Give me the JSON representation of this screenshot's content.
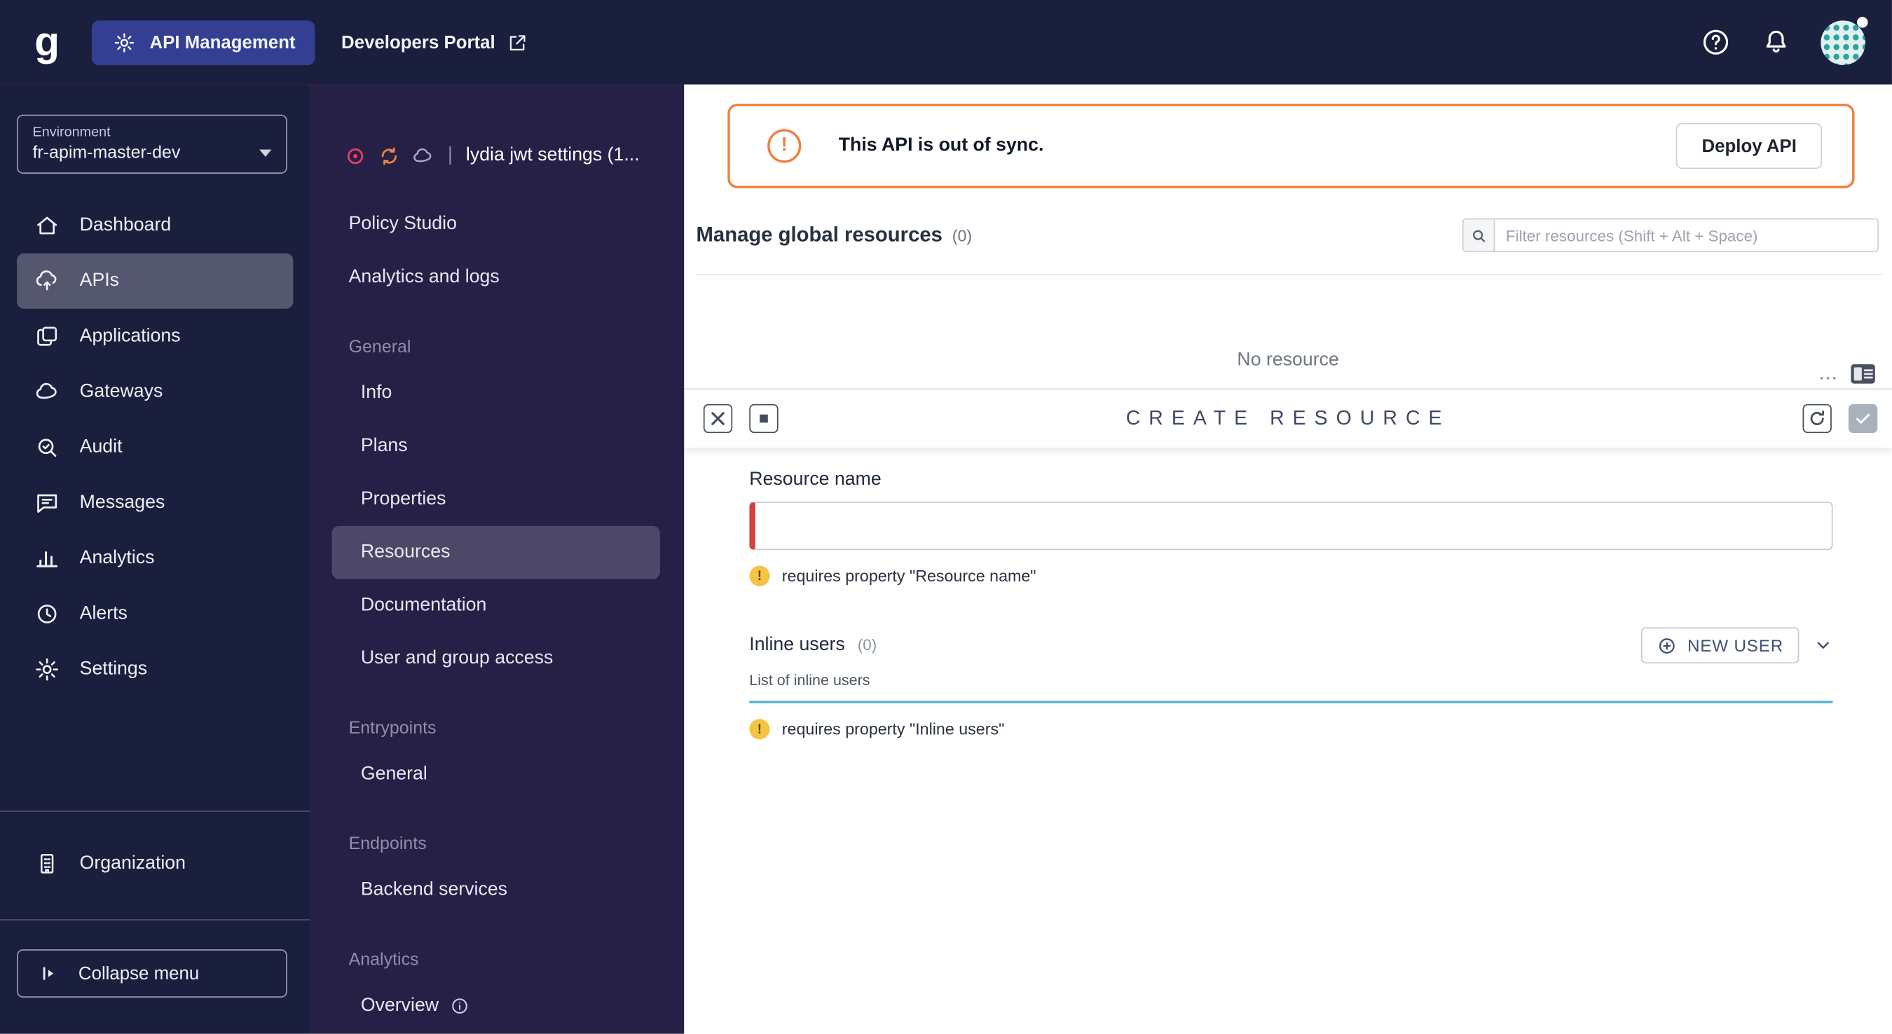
{
  "topbar": {
    "logo_glyph": "g",
    "app_title": "API Management",
    "portal_link": "Developers Portal"
  },
  "sidebar": {
    "environment_label": "Environment",
    "environment_value": "fr-apim-master-dev",
    "items": [
      {
        "label": "Dashboard",
        "icon": "home-icon",
        "active": false
      },
      {
        "label": "APIs",
        "icon": "cloud-apis-icon",
        "active": true
      },
      {
        "label": "Applications",
        "icon": "applications-icon",
        "active": false
      },
      {
        "label": "Gateways",
        "icon": "gateway-cloud-icon",
        "active": false
      },
      {
        "label": "Audit",
        "icon": "audit-search-icon",
        "active": false
      },
      {
        "label": "Messages",
        "icon": "messages-bubble-icon",
        "active": false
      },
      {
        "label": "Analytics",
        "icon": "bar-chart-icon",
        "active": false
      },
      {
        "label": "Alerts",
        "icon": "clock-icon",
        "active": false
      },
      {
        "label": "Settings",
        "icon": "gear-icon",
        "active": false
      }
    ],
    "organization_label": "Organization",
    "collapse_label": "Collapse menu"
  },
  "api_menu": {
    "api_title": "lydia jwt settings (1...",
    "status_icons": [
      "stopped-status-icon",
      "sync-icon",
      "cloud-icon"
    ],
    "items": [
      {
        "label": "Policy Studio",
        "type": "link"
      },
      {
        "label": "Analytics and logs",
        "type": "link"
      },
      {
        "label": "General",
        "type": "header"
      },
      {
        "label": "Info",
        "type": "link"
      },
      {
        "label": "Plans",
        "type": "link"
      },
      {
        "label": "Properties",
        "type": "link"
      },
      {
        "label": "Resources",
        "type": "link",
        "active": true
      },
      {
        "label": "Documentation",
        "type": "link"
      },
      {
        "label": "User and group access",
        "type": "link"
      },
      {
        "label": "Entrypoints",
        "type": "header"
      },
      {
        "label": "General",
        "type": "link"
      },
      {
        "label": "Endpoints",
        "type": "header"
      },
      {
        "label": "Backend services",
        "type": "link"
      },
      {
        "label": "Analytics",
        "type": "header"
      },
      {
        "label": "Overview",
        "type": "link",
        "has_info_icon": true
      }
    ]
  },
  "main": {
    "sync_banner": {
      "message": "This API is out of sync.",
      "deploy_button": "Deploy API"
    },
    "resources_header": {
      "title": "Manage global resources",
      "count": "(0)",
      "filter_placeholder": "Filter resources (Shift + Alt + Space)"
    },
    "empty_state": "No resource",
    "create_panel": {
      "title": "CREATE RESOURCE",
      "resource_name_label": "Resource name",
      "resource_name_value": "",
      "resource_name_error": "requires property \"Resource name\"",
      "inline_users_label": "Inline users",
      "inline_users_count": "(0)",
      "inline_users_hint": "List of inline users",
      "new_user_button": "NEW USER",
      "inline_users_error": "requires property \"Inline users\"",
      "warning_glyph": "!"
    }
  },
  "colors": {
    "navy": "#1b1f3e",
    "submenu_bg": "#262046",
    "brand_chip": "#333f92",
    "warning_orange": "#ee8040",
    "error_red": "#d6403c",
    "teal_divider": "#55b1d3",
    "link_navy": "#3f5075"
  }
}
